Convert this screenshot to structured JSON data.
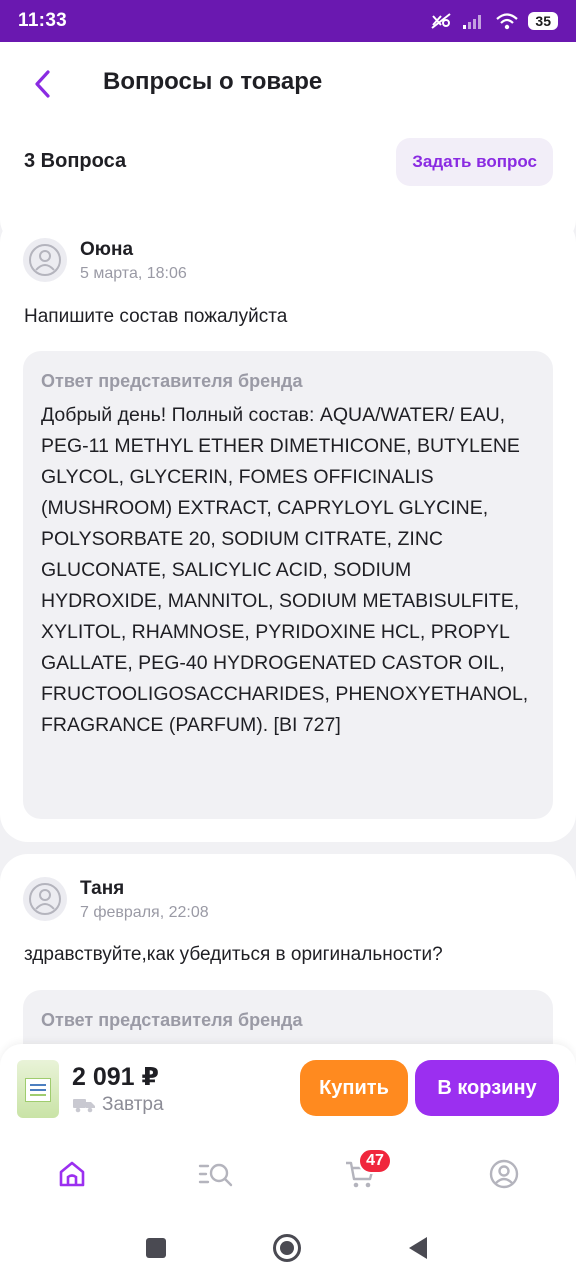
{
  "status_bar": {
    "time": "11:33",
    "battery": "35"
  },
  "header": {
    "title": "Вопросы о товаре",
    "question_count": "3 Вопроса",
    "ask_button": "Задать вопрос"
  },
  "questions": [
    {
      "author": "Оюна",
      "date": "5 марта, 18:06",
      "text": "Напишите состав пожалуйста",
      "answer_label": "Ответ представителя бренда",
      "answer": "Добрый день! Полный состав: AQUA/WATER/ EAU, PEG-11 METHYL ETHER DIMETHICONE, BUTYLENE GLYCOL, GLYCERIN, FOMES OFFICINALIS (MUSHROOM) EXTRACT, CAPRYLOYL GLYCINE, POLYSORBATE 20, SODIUM CITRATE, ZINC GLUCONATE, SALICYLIC ACID, SODIUM HYDROXIDE, MANNITOL, SODIUM METABISULFITE, XYLITOL, RHAMNOSE, PYRIDOXINE HCL, PROPYL GALLATE, PEG-40 HYDROGENATED CASTOR OIL, FRUCTOOLIGOSACCHARIDES, PHENOXYETHANOL, FRAGRANCE (PARFUM). [BI 727]"
    },
    {
      "author": "Таня",
      "date": "7 февраля, 22:08",
      "text": "здравствуйте,как убедиться в оригинальности?",
      "answer_label": "Ответ представителя бренда"
    }
  ],
  "buy_bar": {
    "price": "2 091 ₽",
    "delivery": "Завтра",
    "buy_label": "Купить",
    "cart_label": "В корзину"
  },
  "tab_bar": {
    "cart_badge": "47"
  },
  "colors": {
    "accent": "#9b2ff0",
    "status_bar": "#6a18b0",
    "buy": "#ff8a1f",
    "badge": "#f0263c"
  }
}
